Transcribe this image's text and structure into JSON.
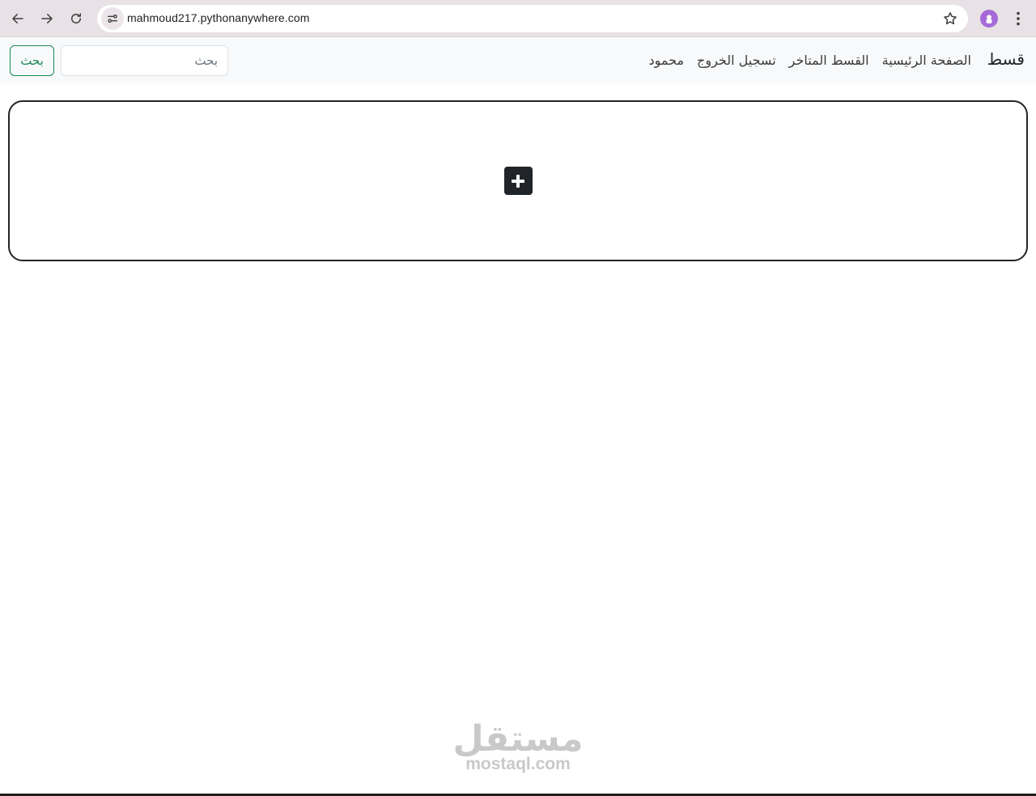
{
  "browser": {
    "url": "mahmoud217.pythonanywhere.com",
    "icons": {
      "back": "back-arrow-icon",
      "forward": "forward-arrow-icon",
      "reload": "reload-icon",
      "site_info": "site-settings-icon",
      "bookmark": "star-icon",
      "profile": "profile-avatar-icon",
      "menu": "kebab-menu-icon"
    }
  },
  "navbar": {
    "brand": "قسط",
    "links": [
      "الصفحة الرئيسية",
      "القسط المتاخر",
      "تسجيل الخروج",
      "محمود"
    ],
    "search_placeholder": "بحث",
    "search_button": "بحث",
    "colors": {
      "background": "#f8f9fa",
      "search_button": "#198754"
    }
  },
  "main": {
    "add_card_icon": "plus-square-icon"
  },
  "watermark": {
    "arabic": "مستقل",
    "english": "mostaql.com"
  }
}
